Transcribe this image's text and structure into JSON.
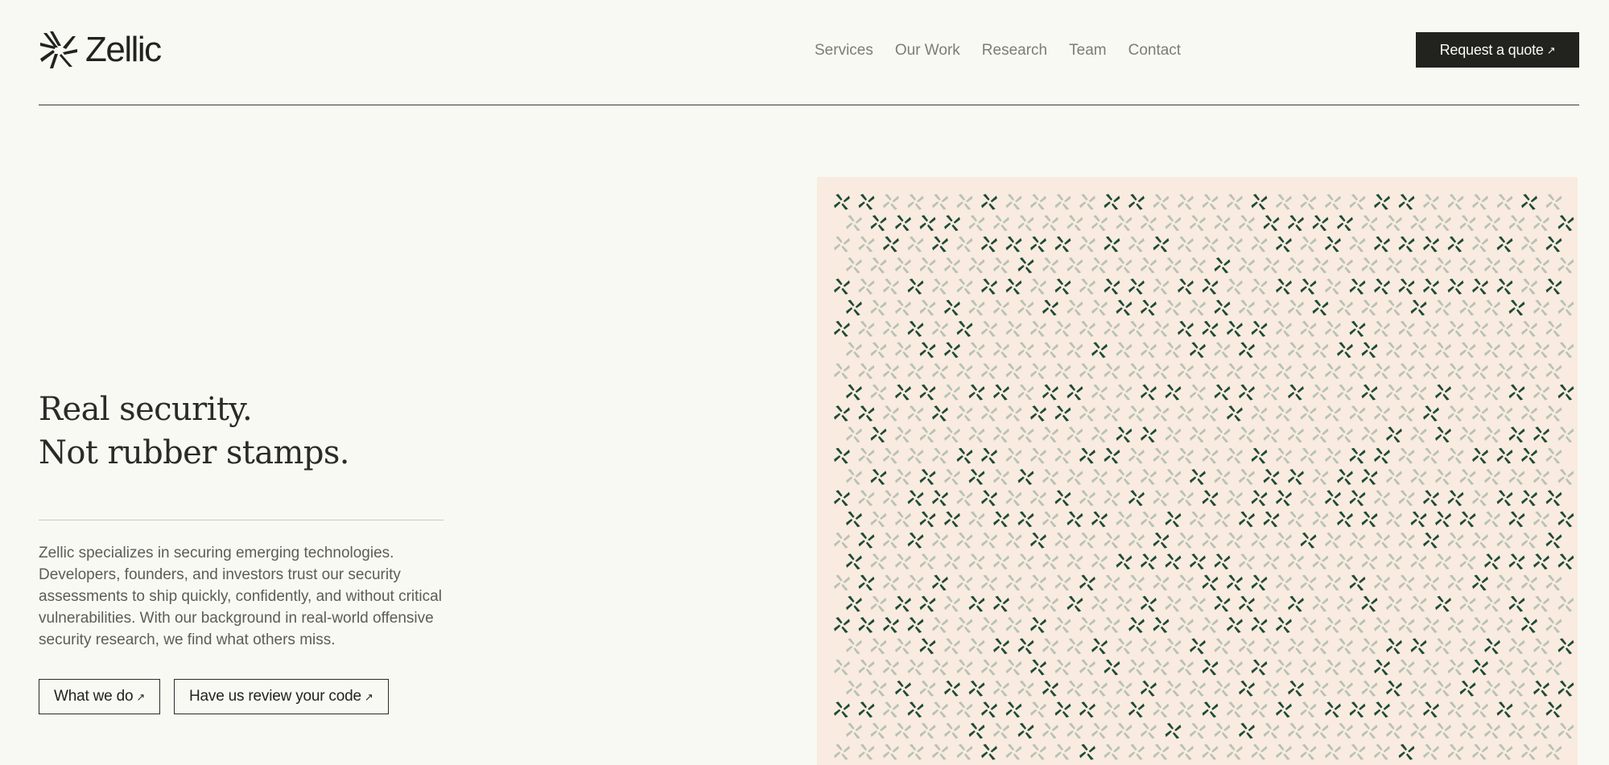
{
  "header": {
    "logo_text": "Zellic",
    "nav": [
      "Services",
      "Our Work",
      "Research",
      "Team",
      "Contact"
    ],
    "cta_label": "Request a quote",
    "cta_arrow": "↗"
  },
  "hero": {
    "title_line1": "Real security.",
    "title_line2": "Not rubber stamps.",
    "description": "Zellic specializes in securing emerging technologies. Developers, founders, and investors trust our security assessments to ship quickly, confidently, and without critical vulnerabilities. With our background in real-world offensive security research, we find what others miss.",
    "buttons": [
      {
        "label": "What we do",
        "arrow": "↗"
      },
      {
        "label": "Have us review your code",
        "arrow": "↗"
      }
    ]
  },
  "pattern": {
    "icon": "pinwheel-icon",
    "colors": {
      "background": "#f9ebdf",
      "light": "#b7c2b3",
      "dark": "#1e4a38"
    }
  },
  "colors": {
    "page_bg": "#f9f9f4",
    "text": "#22231f",
    "nav_text": "#7c7d77",
    "button_bg": "#22231f"
  }
}
